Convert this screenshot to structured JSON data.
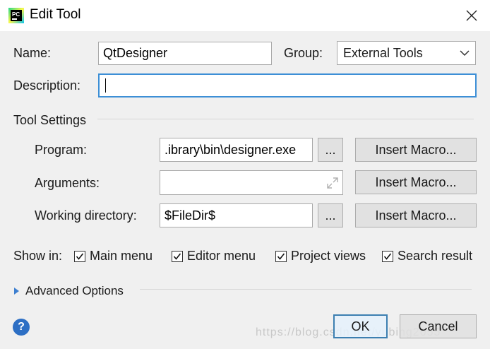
{
  "window": {
    "title": "Edit Tool",
    "app_icon_text": "PC"
  },
  "form": {
    "name_label": "Name:",
    "name_value": "QtDesigner",
    "group_label": "Group:",
    "group_value": "External Tools",
    "description_label": "Description:",
    "description_value": ""
  },
  "tool_settings": {
    "section_label": "Tool Settings",
    "program_label": "Program:",
    "program_value": ".ibrary\\bin\\designer.exe",
    "arguments_label": "Arguments:",
    "arguments_value": "",
    "working_dir_label": "Working directory:",
    "working_dir_value": "$FileDir$",
    "browse_label": "...",
    "insert_macro_label": "Insert Macro..."
  },
  "show_in": {
    "label": "Show in:",
    "options": [
      {
        "label": "Main menu",
        "checked": true
      },
      {
        "label": "Editor menu",
        "checked": true
      },
      {
        "label": "Project views",
        "checked": true
      },
      {
        "label": "Search result",
        "checked": true
      }
    ]
  },
  "advanced": {
    "label": "Advanced Options"
  },
  "buttons": {
    "ok": "OK",
    "cancel": "Cancel",
    "help": "?"
  },
  "watermark": "https://blog.csdn.net/yubing2055"
}
